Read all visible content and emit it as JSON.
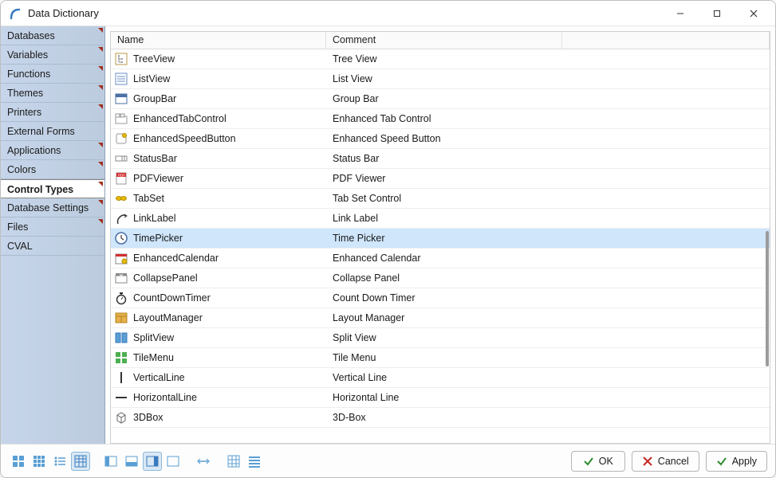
{
  "window": {
    "title": "Data Dictionary"
  },
  "sidebar": {
    "items": [
      {
        "label": "Databases",
        "corner": true
      },
      {
        "label": "Variables",
        "corner": true
      },
      {
        "label": "Functions",
        "corner": true
      },
      {
        "label": "Themes",
        "corner": true
      },
      {
        "label": "Printers",
        "corner": true
      },
      {
        "label": "External Forms",
        "corner": false
      },
      {
        "label": "Applications",
        "corner": true
      },
      {
        "label": "Colors",
        "corner": true
      },
      {
        "label": "Control Types",
        "corner": true,
        "active": true
      },
      {
        "label": "Database Settings",
        "corner": true
      },
      {
        "label": "Files",
        "corner": true
      },
      {
        "label": "CVAL",
        "corner": false
      }
    ]
  },
  "grid": {
    "columns": {
      "name": "Name",
      "comment": "Comment"
    },
    "selectedIndex": 9,
    "rows": [
      {
        "name": "TreeView",
        "comment": "Tree View",
        "icon": "tree"
      },
      {
        "name": "ListView",
        "comment": "List View",
        "icon": "list"
      },
      {
        "name": "GroupBar",
        "comment": "Group Bar",
        "icon": "groupbar"
      },
      {
        "name": "EnhancedTabControl",
        "comment": "Enhanced Tab Control",
        "icon": "tab"
      },
      {
        "name": "EnhancedSpeedButton",
        "comment": "Enhanced Speed Button",
        "icon": "speedbtn"
      },
      {
        "name": "StatusBar",
        "comment": "Status Bar",
        "icon": "statusbar"
      },
      {
        "name": "PDFViewer",
        "comment": "PDF Viewer",
        "icon": "pdf"
      },
      {
        "name": "TabSet",
        "comment": "Tab Set Control",
        "icon": "tabset"
      },
      {
        "name": "LinkLabel",
        "comment": "Link Label",
        "icon": "link"
      },
      {
        "name": "TimePicker",
        "comment": "Time Picker",
        "icon": "clock"
      },
      {
        "name": "EnhancedCalendar",
        "comment": "Enhanced Calendar",
        "icon": "calendar"
      },
      {
        "name": "CollapsePanel",
        "comment": "Collapse Panel",
        "icon": "collapse"
      },
      {
        "name": "CountDownTimer",
        "comment": "Count Down Timer",
        "icon": "timer"
      },
      {
        "name": "LayoutManager",
        "comment": "Layout Manager",
        "icon": "layout"
      },
      {
        "name": "SplitView",
        "comment": "Split View",
        "icon": "split"
      },
      {
        "name": "TileMenu",
        "comment": "Tile Menu",
        "icon": "tile"
      },
      {
        "name": "VerticalLine",
        "comment": "Vertical Line",
        "icon": "vline"
      },
      {
        "name": "HorizontalLine",
        "comment": "Horizontal Line",
        "icon": "hline"
      },
      {
        "name": "3DBox",
        "comment": "3D-Box",
        "icon": "box3d"
      }
    ]
  },
  "footer": {
    "ok": "OK",
    "cancel": "Cancel",
    "apply": "Apply"
  }
}
